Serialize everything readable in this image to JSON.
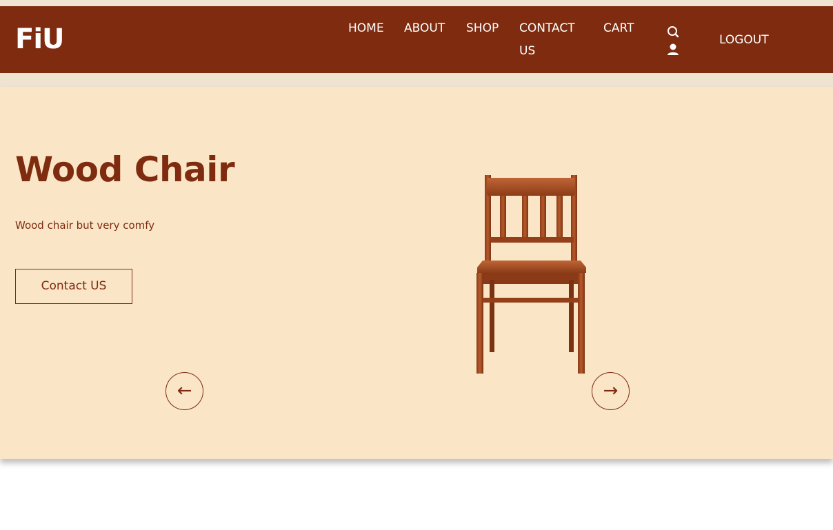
{
  "brand": {
    "logo": "FiU"
  },
  "nav": {
    "items": [
      {
        "label": "HOME"
      },
      {
        "label": "ABOUT"
      },
      {
        "label": "SHOP"
      },
      {
        "label": "CONTACT US"
      },
      {
        "label": "CART"
      }
    ],
    "icons": [
      "search-icon",
      "user-icon"
    ],
    "logout_label": "LOGOUT"
  },
  "hero": {
    "title": "Wood Chair",
    "description": "Wood chair but very comfy",
    "button_label": "Contact US",
    "prev_arrow": "←",
    "next_arrow": "→",
    "image": "wood-chair-image"
  },
  "colors": {
    "brand": "#7e2b0f",
    "hero_bg": "#fae5c6",
    "strip_bg": "#efe3d2",
    "text_light": "#ffffff"
  }
}
